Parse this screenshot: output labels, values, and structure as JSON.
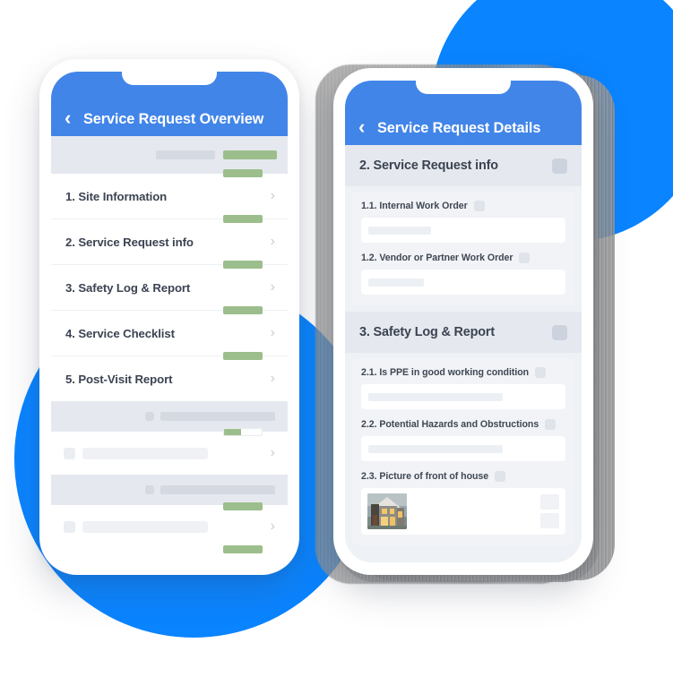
{
  "theme": {
    "header_blue": "#4285e8",
    "accent_blue": "#0a84ff",
    "progress_green": "#9cbe8c",
    "placeholder_grey": "#d5d9e1",
    "text_dark": "#3b4351"
  },
  "left_phone": {
    "appbar": {
      "back_icon": "‹",
      "title": "Service Request Overview"
    },
    "top_strip": {
      "grey_bar_width": 66,
      "green_bar_width": 60
    },
    "sections": [
      {
        "label": "1. Site Information",
        "chevron": "›",
        "progress": 100
      },
      {
        "label": "2. Service Request info",
        "chevron": "›",
        "progress": 100
      },
      {
        "label": "3. Safety Log & Report",
        "chevron": "›",
        "progress": 100
      },
      {
        "label": "4. Service Checklist",
        "chevron": "›",
        "progress": 100
      },
      {
        "label": "5. Post-Visit Report",
        "chevron": "›",
        "progress": 100
      }
    ],
    "skeleton_groups": [
      {
        "header_square_width": 10,
        "header_bar_width": 128,
        "row_line_width": 140,
        "progress": 45,
        "chevron": "›"
      },
      {
        "header_square_width": 10,
        "header_bar_width": 128,
        "row_line_width": 140,
        "progress": 100,
        "chevron": "›"
      },
      {
        "row_line_width": 100,
        "progress": 100,
        "chevron": "›"
      }
    ]
  },
  "right_phone": {
    "appbar": {
      "back_icon": "‹",
      "title": "Service Request Details"
    },
    "sections": [
      {
        "title": "2. Service Request info",
        "fields": [
          {
            "label": "1.1. Internal Work Order",
            "type": "text",
            "ghost_width": 70
          },
          {
            "label": "1.2. Vendor or Partner Work Order",
            "type": "text",
            "ghost_width": 62
          }
        ]
      },
      {
        "title": "3. Safety Log & Report",
        "fields": [
          {
            "label": "2.1. Is PPE in good working condition",
            "type": "text",
            "ghost_width": 150
          },
          {
            "label": "2.2. Potential Hazards and Obstructions",
            "type": "text",
            "ghost_width": 150
          },
          {
            "label": "2.3. Picture of front of house",
            "type": "photo",
            "photo_alt": "modern two-storey house with grey siding and lit windows"
          }
        ]
      }
    ]
  }
}
